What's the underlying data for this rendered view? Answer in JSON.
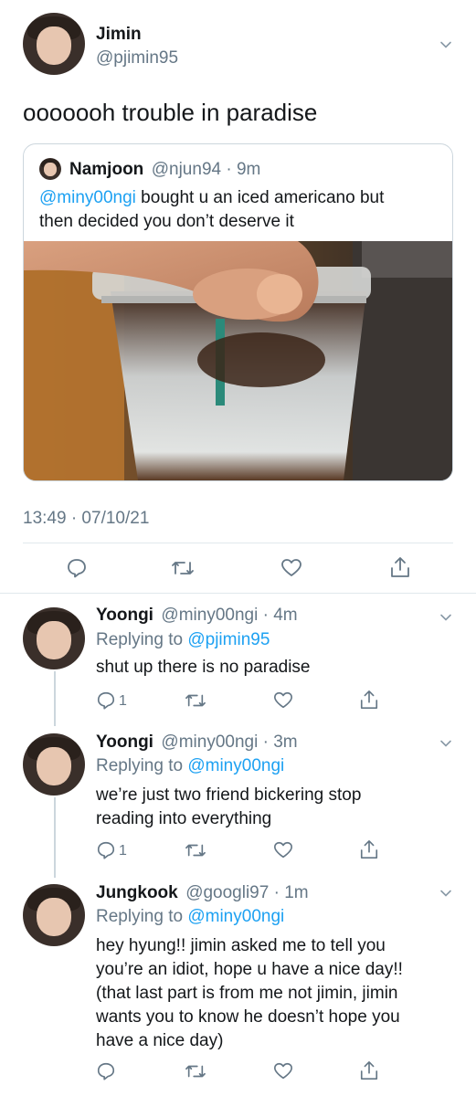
{
  "main_tweet": {
    "display_name": "Jimin",
    "handle": "@pjimin95",
    "text": "ooooooh trouble in paradise",
    "timestamp": "13:49 · 07/10/21"
  },
  "quoted_tweet": {
    "display_name": "Namjoon",
    "handle_time": "@njun94 · 9m",
    "mention": "@miny00ngi",
    "text_line1_rest": " bought u an iced americano but",
    "text_line2": "then decided you don’t deserve it",
    "image_alt": "hand holding iced americano cup"
  },
  "replies": [
    {
      "display_name": "Yoongi",
      "handle_time": "@miny00ngi · 4m",
      "replying_prefix": "Replying to ",
      "replying_to": "@pjimin95",
      "lines": [
        "shut up there is no paradise"
      ],
      "reply_count": "1"
    },
    {
      "display_name": "Yoongi",
      "handle_time": "@miny00ngi · 3m",
      "replying_prefix": "Replying to ",
      "replying_to": "@miny00ngi",
      "lines": [
        "we’re just two friend bickering stop",
        "reading into everything"
      ],
      "reply_count": "1"
    },
    {
      "display_name": "Jungkook",
      "handle_time": "@googli97 · 1m",
      "replying_prefix": "Replying to ",
      "replying_to": "@miny00ngi",
      "lines": [
        "hey hyung!! jimin asked me to tell you",
        "you’re an idiot, hope u have a nice day!!",
        "(that last part is from me not jimin, jimin",
        "wants you to know he doesn’t hope you",
        "have a nice day)"
      ],
      "reply_count": ""
    }
  ],
  "icons": {
    "reply": "reply-icon",
    "retweet": "retweet-icon",
    "like": "heart-icon",
    "share": "share-icon",
    "more": "chevron-down-icon"
  },
  "colors": {
    "link": "#1da1f2",
    "muted": "#657786",
    "icon": "#657786"
  }
}
